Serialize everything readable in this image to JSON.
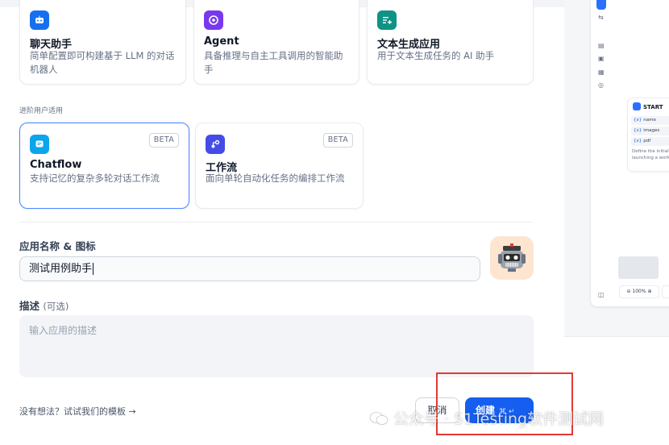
{
  "app_types_row1": [
    {
      "title": "聊天助手",
      "desc": "简单配置即可构建基于 LLM 的对话机器人",
      "icon": "chat-bot-icon",
      "color": "#1570ef"
    },
    {
      "title": "Agent",
      "desc": "具备推理与自主工具调用的智能助手",
      "icon": "agent-icon",
      "color": "#7839ee"
    },
    {
      "title": "文本生成应用",
      "desc": "用于文本生成任务的 AI 助手",
      "icon": "text-generation-icon",
      "color": "#0e9384"
    }
  ],
  "advanced_section_label": "进阶用户适用",
  "app_types_row2": [
    {
      "title": "Chatflow",
      "desc": "支持记忆的复杂多轮对话工作流",
      "badge": "BETA",
      "icon": "chatflow-icon",
      "color": "#0ba5ec",
      "selected": true
    },
    {
      "title": "工作流",
      "desc": "面向单轮自动化任务的编排工作流",
      "badge": "BETA",
      "icon": "workflow-icon",
      "color": "#444ce7",
      "selected": false
    }
  ],
  "name_field": {
    "label": "应用名称 & 图标",
    "value": "测试用例助手"
  },
  "description_field": {
    "label": "描述",
    "optional": "(可选)",
    "placeholder": "输入应用的描述"
  },
  "template_link": "没有想法？试试我们的模板 →",
  "buttons": {
    "cancel": "取消",
    "create": "创建",
    "create_shortcut": "⌘ ↵"
  },
  "watermark": "公众号 · 51Testing软件测试网",
  "preview": {
    "start_node_title": "START",
    "variables": [
      "name",
      "images",
      "pdf"
    ],
    "note": "Define the initial launching a work",
    "zoom": "100%"
  },
  "colors": {
    "primary": "#155eef",
    "selected_border": "#528bff",
    "highlight_box": "#e23a33"
  }
}
